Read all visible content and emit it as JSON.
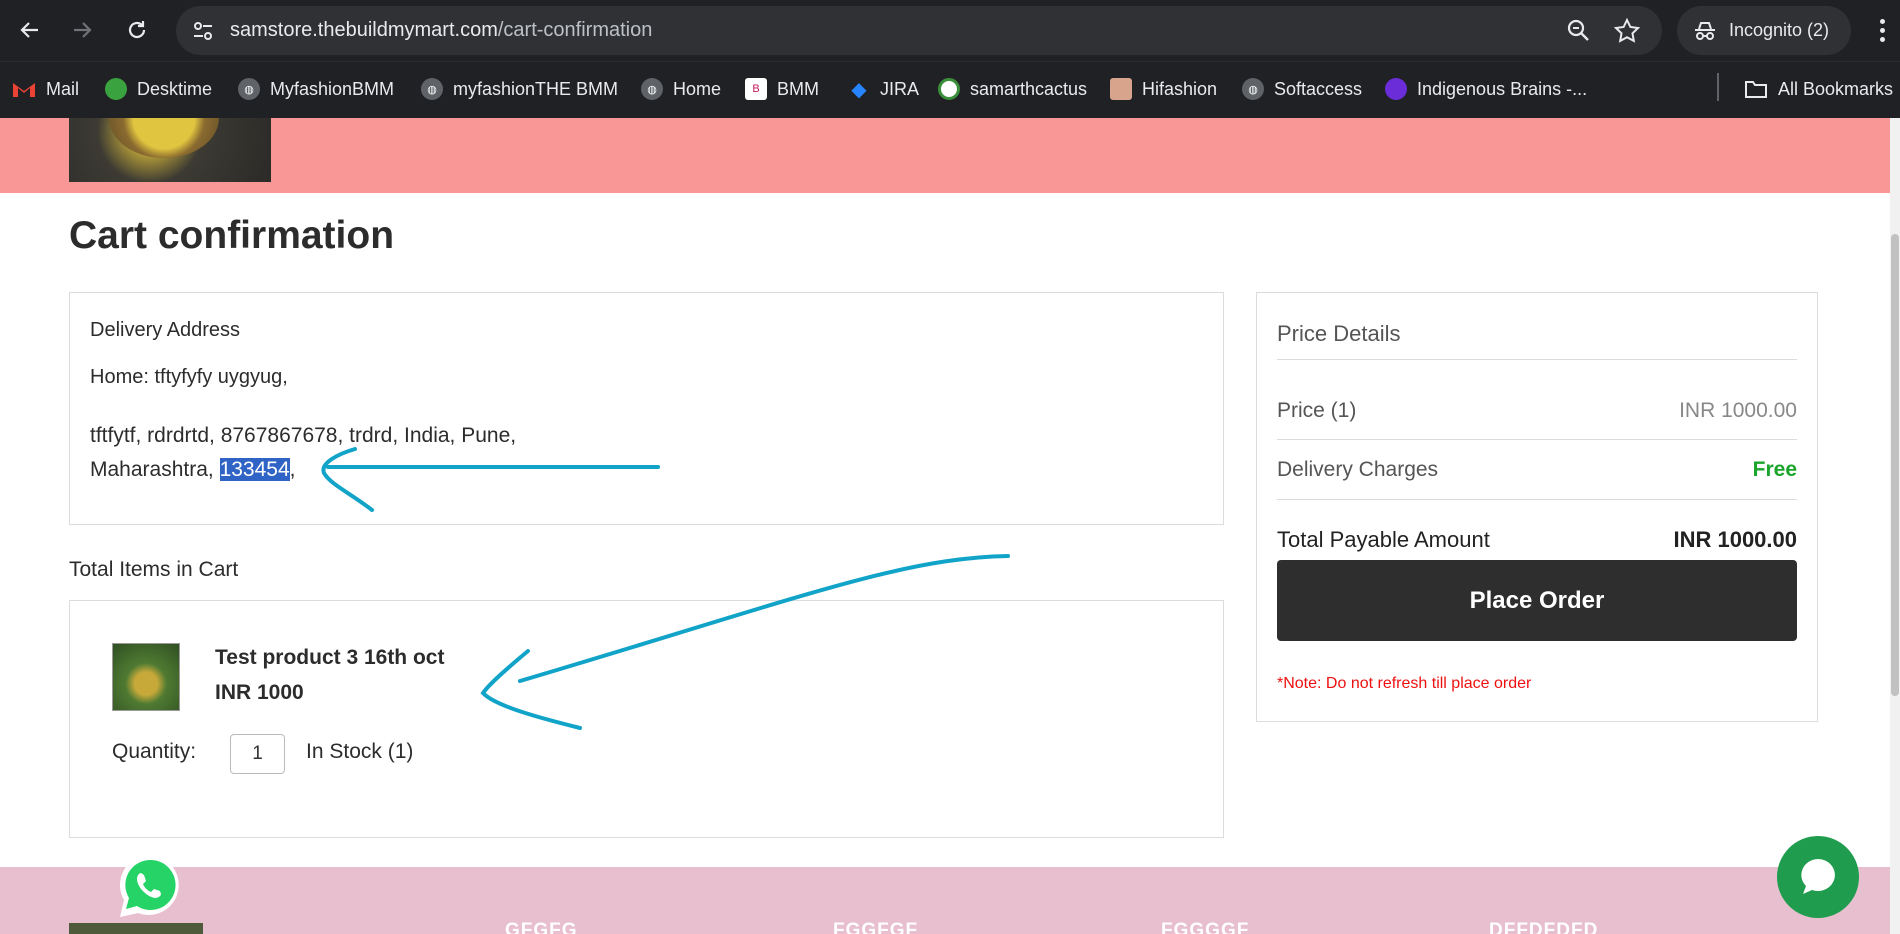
{
  "browser": {
    "url_host": "samstore.thebuildmymart.com",
    "url_path": "/cart-confirmation",
    "incognito_label": "Incognito (2)",
    "bookmarks": [
      {
        "label": "Mail",
        "icon": "gmail-icon"
      },
      {
        "label": "Desktime",
        "icon": "desktime-icon"
      },
      {
        "label": "MyfashionBMM",
        "icon": "globe-icon"
      },
      {
        "label": "myfashionTHE BMM",
        "icon": "globe-icon"
      },
      {
        "label": "Home",
        "icon": "globe-icon"
      },
      {
        "label": "BMM",
        "icon": "bmm-icon"
      },
      {
        "label": "JIRA",
        "icon": "jira-icon"
      },
      {
        "label": "samarthcactus",
        "icon": "cactus-icon"
      },
      {
        "label": "Hifashion",
        "icon": "avatar-icon"
      },
      {
        "label": "Softaccess",
        "icon": "globe-icon"
      },
      {
        "label": "Indigenous Brains -...",
        "icon": "brains-icon"
      }
    ],
    "all_bookmarks_label": "All Bookmarks"
  },
  "page": {
    "title": "Cart confirmation",
    "delivery": {
      "heading": "Delivery Address",
      "home_line": "Home: tftyfyfy uygyug,",
      "address_line_1": "tftfytf, rdrdrtd, 8767867678, trdrd, India, Pune,",
      "address_line_2": "Maharashtra, ",
      "pincode": "133454",
      "trailing": ","
    },
    "items_heading": "Total Items in Cart",
    "item": {
      "name": "Test product 3 16th oct",
      "price": "INR 1000",
      "quantity_label": "Quantity:",
      "quantity": "1",
      "stock": "In Stock (1)"
    },
    "price_details": {
      "heading": "Price Details",
      "price_label": "Price  (1)",
      "price_value": "INR 1000.00",
      "delivery_label": "Delivery Charges",
      "delivery_value": "Free",
      "total_label": "Total Payable Amount",
      "total_value": "INR  1000.00",
      "place_order": "Place Order",
      "note": "*Note: Do not refresh till place order"
    },
    "footer_headings": [
      "GFGFG",
      "FGGFGF",
      "FGGGGF",
      "DFFDFDFD"
    ]
  },
  "colors": {
    "header_band": "#f99696",
    "footer_band": "#e8bfcf",
    "annotation_arrow": "#12a4c8",
    "free_green": "#1aa52a",
    "note_red": "#e11111",
    "selection_blue": "#2f64c6"
  }
}
